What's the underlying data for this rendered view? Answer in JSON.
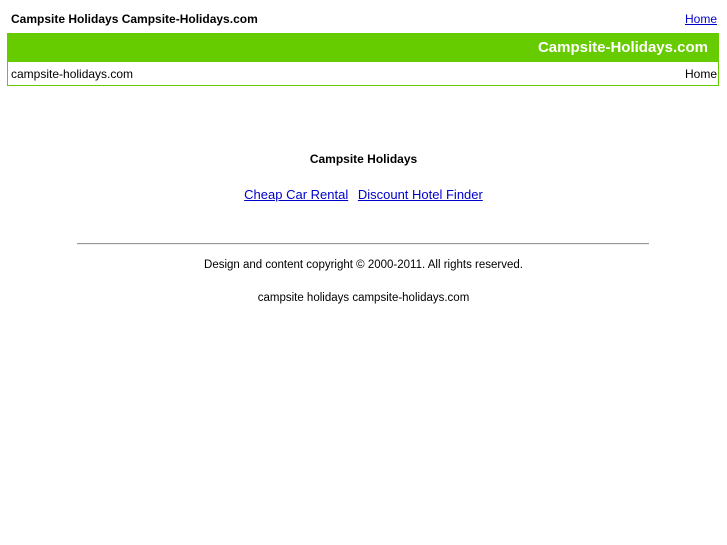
{
  "top_bar": {
    "site_title": "Campsite Holidays Campsite-Holidays.com",
    "home_link": "Home"
  },
  "header": {
    "brand": "Campsite-Holidays.com",
    "domain": "campsite-holidays.com",
    "home_label": "Home"
  },
  "main": {
    "heading": "Campsite Holidays",
    "links": [
      {
        "label": "Cheap Car Rental"
      },
      {
        "label": "Discount Hotel Finder"
      }
    ]
  },
  "footer": {
    "copyright": "Design and content copyright © 2000-2011. All rights reserved.",
    "keywords": "campsite holidays campsite-holidays.com"
  },
  "colors": {
    "accent_green": "#66cc00",
    "link_blue": "#0000cc"
  }
}
